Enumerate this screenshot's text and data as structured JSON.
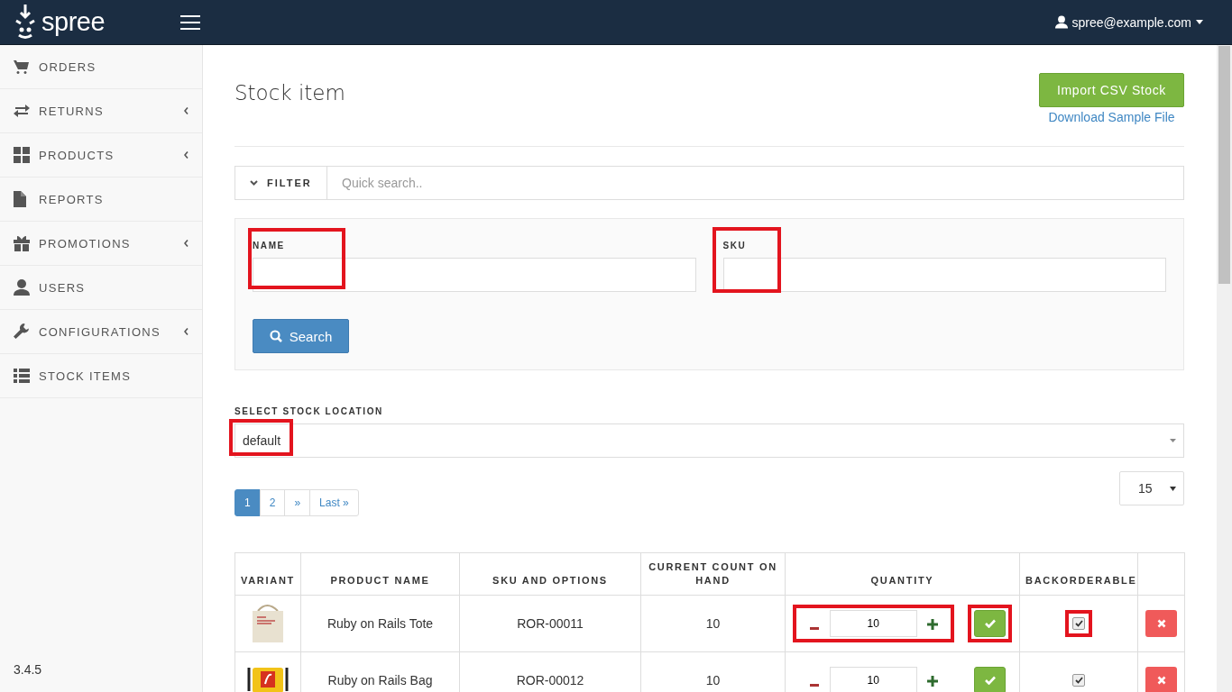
{
  "brand": {
    "name": "spree"
  },
  "user": {
    "email": "spree@example.com"
  },
  "sidebar": {
    "items": [
      {
        "label": "ORDERS",
        "kind": "cart",
        "has_submenu": false
      },
      {
        "label": "RETURNS",
        "kind": "arrows",
        "has_submenu": true
      },
      {
        "label": "PRODUCTS",
        "kind": "grid",
        "has_submenu": true
      },
      {
        "label": "REPORTS",
        "kind": "file",
        "has_submenu": false
      },
      {
        "label": "PROMOTIONS",
        "kind": "gift",
        "has_submenu": true
      },
      {
        "label": "USERS",
        "kind": "user",
        "has_submenu": false
      },
      {
        "label": "CONFIGURATIONS",
        "kind": "wrench",
        "has_submenu": true
      },
      {
        "label": "STOCK ITEMS",
        "kind": "list",
        "has_submenu": false
      }
    ],
    "version": "3.4.5"
  },
  "page": {
    "title": "Stock item",
    "import_button": "Import CSV Stock",
    "sample_link": "Download Sample File"
  },
  "filter": {
    "toggle": "FILTER",
    "placeholder": "Quick search..",
    "fields": [
      {
        "label": "NAME",
        "highlighted": true
      },
      {
        "label": "SKU",
        "highlighted": true
      }
    ],
    "search_button": "Search"
  },
  "stock_location": {
    "label": "SELECT STOCK LOCATION",
    "value": "default",
    "highlighted": true
  },
  "pagination": {
    "pages": [
      {
        "label": "1",
        "selected": true
      },
      {
        "label": "2",
        "selected": false
      },
      {
        "label": "»",
        "selected": false
      },
      {
        "label": "Last »",
        "selected": false
      }
    ]
  },
  "per_page": "15",
  "table": {
    "columns": [
      "VARIANT",
      "PRODUCT NAME",
      "SKU AND OPTIONS",
      "CURRENT COUNT ON HAND",
      "QUANTITY",
      "BACKORDERABLE"
    ],
    "rows": [
      {
        "kind": "tote",
        "product_name": "Ruby on Rails Tote",
        "sku": "ROR-00011",
        "count_on_hand": "10",
        "quantity": "10",
        "quantity_highlighted": true,
        "save_highlighted": true,
        "backorderable": true,
        "backorderable_highlighted": true
      },
      {
        "kind": "bag",
        "product_name": "Ruby on Rails Bag",
        "sku": "ROR-00012",
        "count_on_hand": "10",
        "quantity": "10",
        "quantity_highlighted": false,
        "save_highlighted": false,
        "backorderable": true,
        "backorderable_highlighted": false
      }
    ]
  }
}
